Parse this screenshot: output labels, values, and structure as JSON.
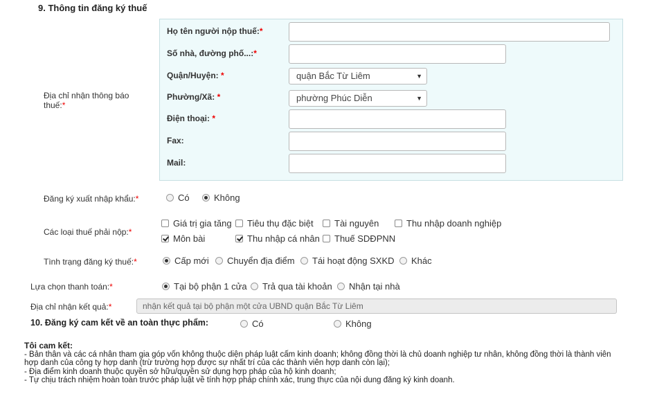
{
  "section9": {
    "title": "9. Thông tin đăng ký thuế",
    "address_label": "Địa chỉ nhận thông báo thuế:",
    "required_mark": "*",
    "fields": {
      "taxpayer_name_label": "Họ tên người nộp thuế:",
      "street_label": "Số nhà, đường phố...:",
      "district_label": "Quận/Huyện: ",
      "district_value": "quận Bắc Từ Liêm",
      "ward_label": "Phường/Xã: ",
      "ward_value": "phường Phúc Diễn",
      "phone_label": "Điện thoại: ",
      "fax_label": "Fax:",
      "mail_label": "Mail:"
    },
    "import_export": {
      "label": "Đăng ký xuất nhập khẩu:",
      "options": [
        "Có",
        "Không"
      ],
      "selected": "Không"
    },
    "tax_types": {
      "label": "Các loại thuế phải nộp:",
      "options": [
        {
          "label": "Giá trị gia tăng",
          "checked": false
        },
        {
          "label": "Tiêu thụ đặc biệt",
          "checked": false
        },
        {
          "label": "Tài nguyên",
          "checked": false
        },
        {
          "label": "Thu nhập doanh nghiệp",
          "checked": false
        },
        {
          "label": "Môn bài",
          "checked": true
        },
        {
          "label": "Thu nhập cá nhân",
          "checked": true
        },
        {
          "label": "Thuế SDĐPNN",
          "checked": false
        }
      ]
    },
    "tax_status": {
      "label": "Tình trạng đăng ký thuế:",
      "options": [
        "Cấp mới",
        "Chuyển địa điểm",
        "Tái hoạt động SXKD",
        "Khác"
      ],
      "selected": "Cấp mới"
    }
  },
  "payment": {
    "label": "Lựa chọn thanh toán:",
    "options": [
      "Tại bộ phận 1 cửa",
      "Trả qua tài khoản",
      "Nhận tại nhà"
    ],
    "selected": "Tại bộ phận 1 cửa"
  },
  "result_address": {
    "label": "Địa chỉ nhận kết quả:",
    "value": "nhận kết quả tại bộ phận một cửa UBND quận Bắc Từ Liêm"
  },
  "section10": {
    "title": "10. Đăng ký cam kết về an toàn thực phẩm:",
    "options": [
      "Có",
      "Không"
    ],
    "selected": ""
  },
  "commitment": {
    "title": "Tôi cam kết:",
    "lines": [
      "- Bản thân và các cá nhân tham gia góp vốn không thuộc diện pháp luật cấm kinh doanh; không đồng thời là chủ doanh nghiệp tư nhân, không đồng thời là thành viên",
      "hợp danh của công ty hợp danh (trừ trường hợp được sự nhất trí của các thành viên hợp danh còn lại);",
      "- Địa điểm kinh doanh thuộc quyền sở hữu/quyền sử dụng hợp pháp của hộ kinh doanh;",
      "- Tự chịu trách nhiệm hoàn toàn trước pháp luật về tính hợp pháp chính xác, trung thực của nội dung đăng ký kinh doanh."
    ]
  }
}
